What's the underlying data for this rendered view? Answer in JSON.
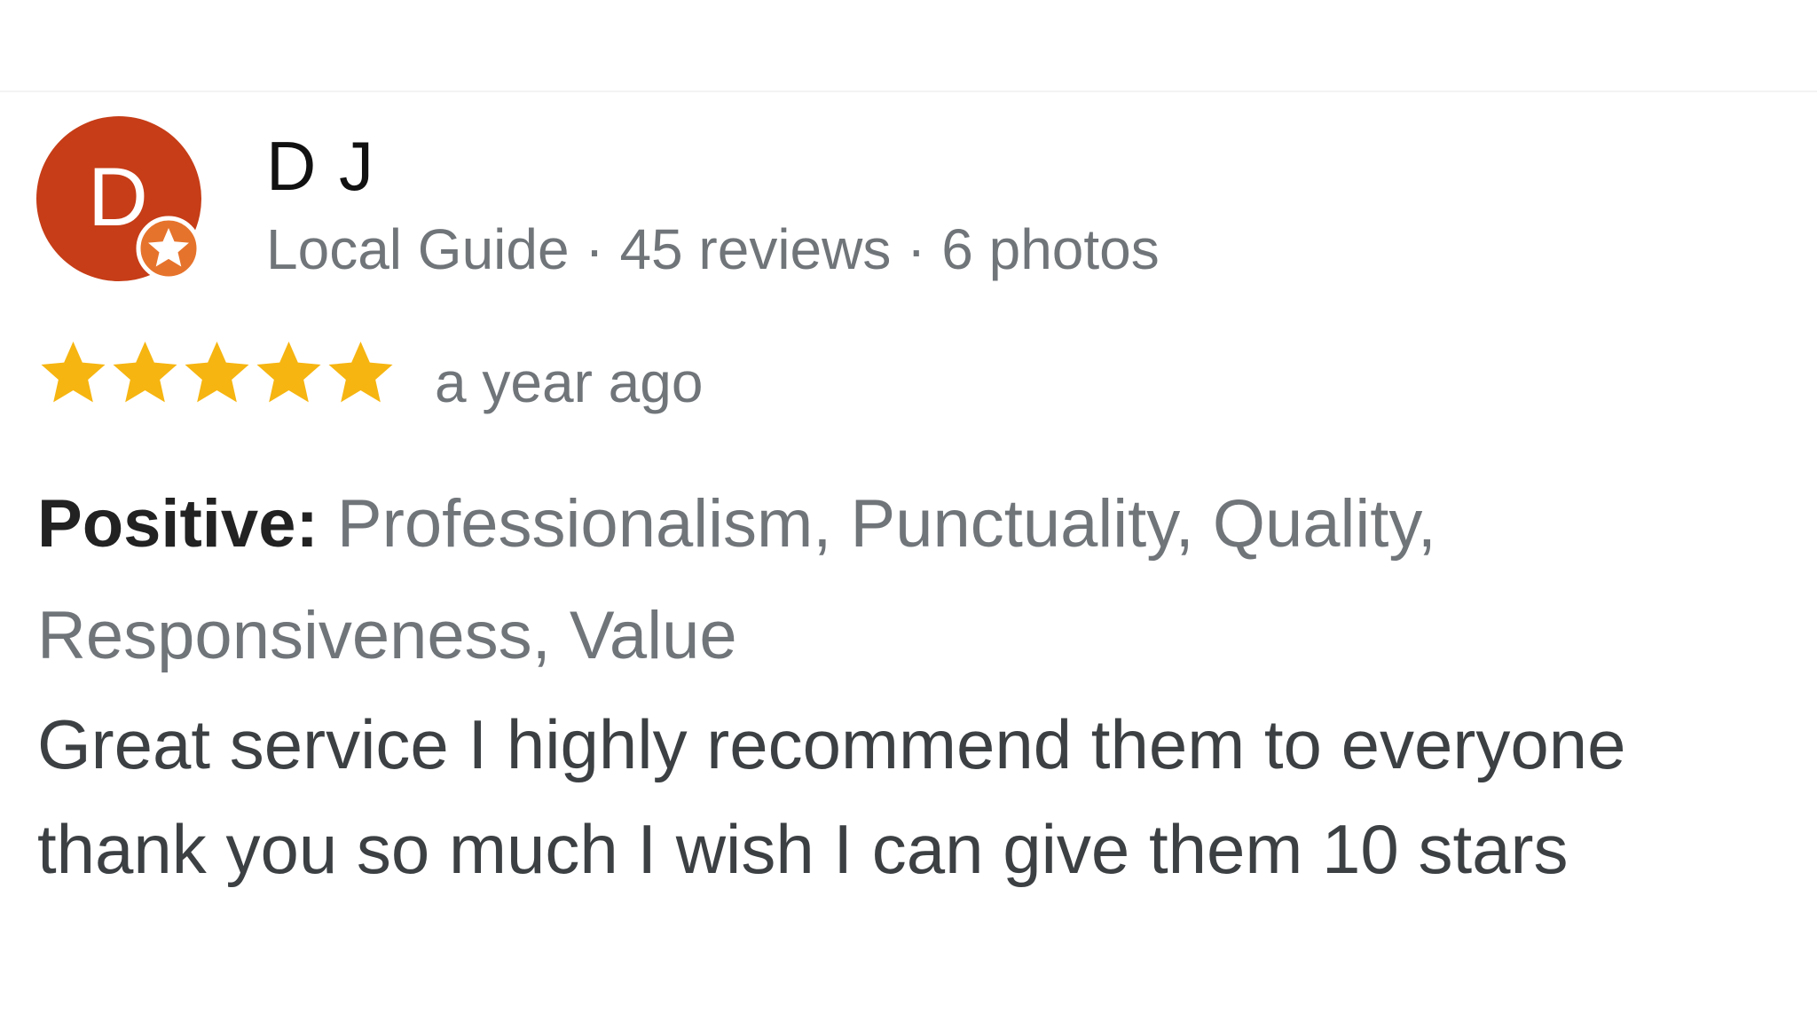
{
  "reviewer": {
    "avatar_letter": "D",
    "avatar_color": "#c63d17",
    "badge_icon": "local-guide-star-badge",
    "name": "D J",
    "meta": "Local Guide · 45 reviews · 6 photos"
  },
  "rating": {
    "stars": 5,
    "max_stars": 5,
    "star_color": "#f6b511",
    "date": "a year ago"
  },
  "attributes": {
    "label": "Positive:",
    "values": "Professionalism, Punctuality, Quality, Responsiveness, Value"
  },
  "review": {
    "text": "Great service I highly recommend them to everyone thank you so much I wish I can give them 10 stars"
  }
}
